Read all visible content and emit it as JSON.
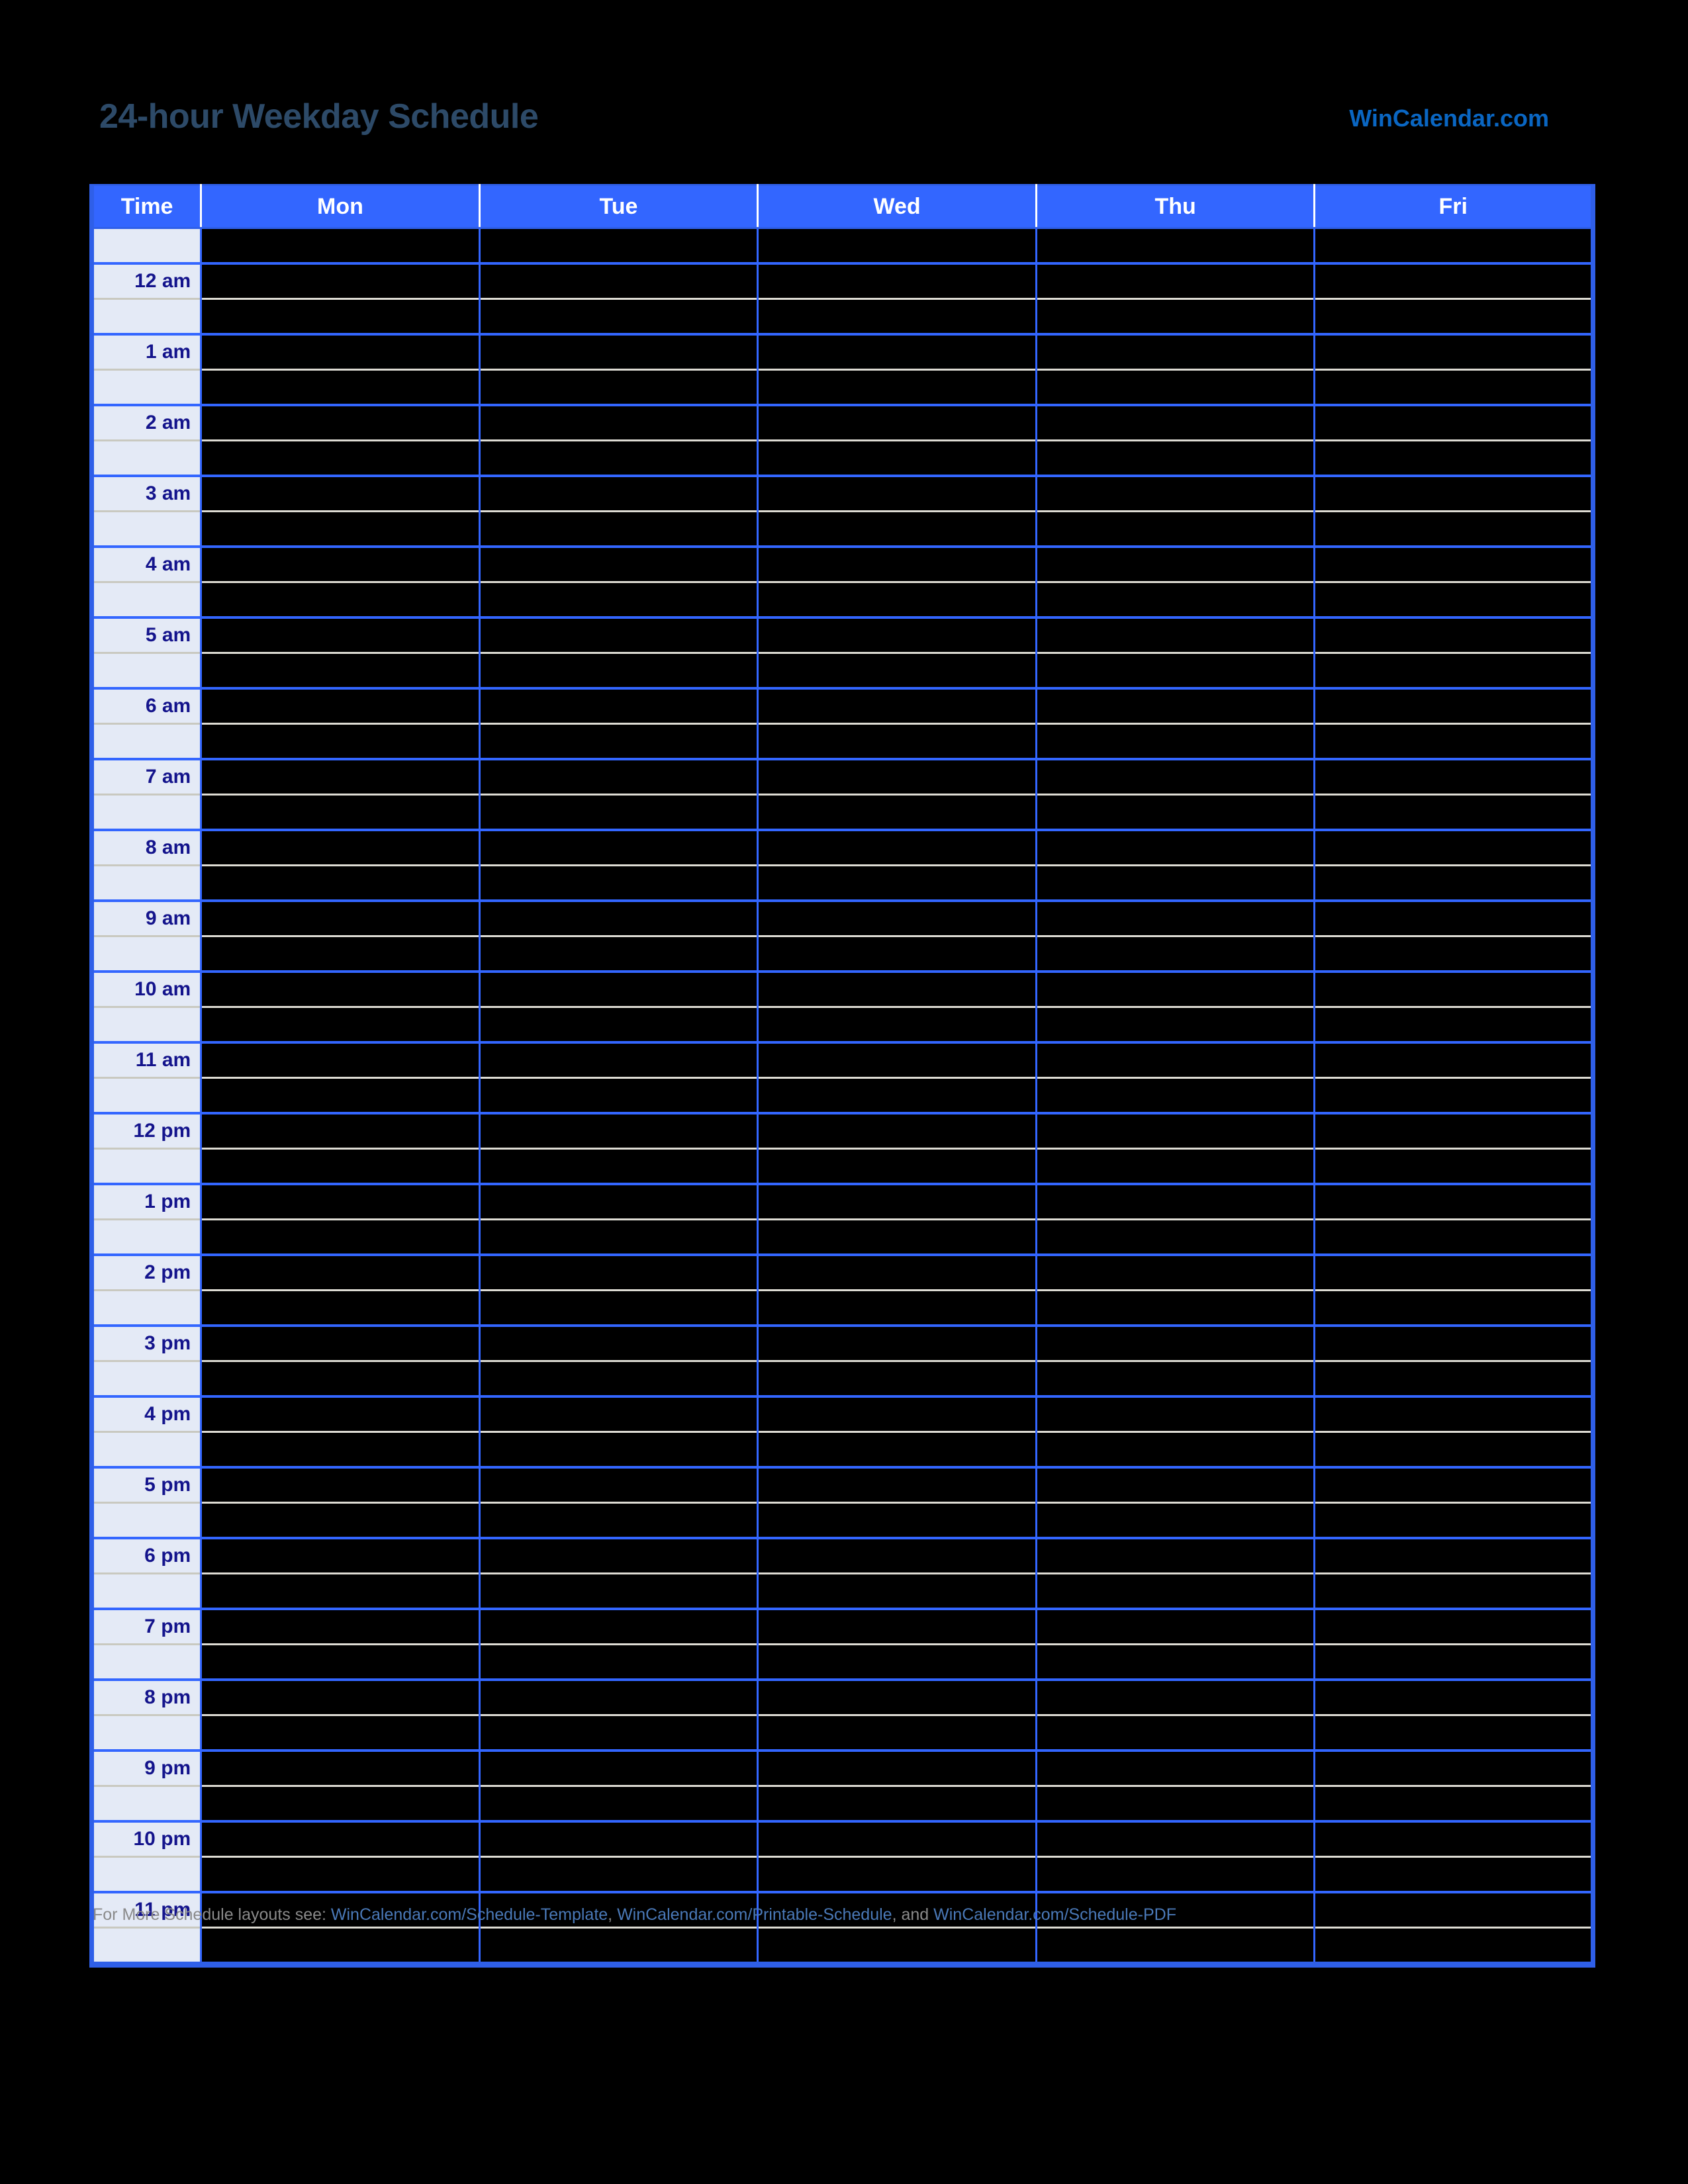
{
  "document": {
    "title": "24-hour Weekday Schedule",
    "brand": "WinCalendar.com"
  },
  "table": {
    "columns": [
      "Time",
      "Mon",
      "Tue",
      "Wed",
      "Thu",
      "Fri"
    ],
    "time_column_header": "Time",
    "day_headers": [
      "Mon",
      "Tue",
      "Wed",
      "Thu",
      "Fri"
    ],
    "hour_labels": [
      "12 am",
      "1 am",
      "2 am",
      "3 am",
      "4 am",
      "5 am",
      "6 am",
      "7 am",
      "8 am",
      "9 am",
      "10 am",
      "11 am",
      "12 pm",
      "1 pm",
      "2 pm",
      "3 pm",
      "4 pm",
      "5 pm",
      "6 pm",
      "7 pm",
      "8 pm",
      "9 pm",
      "10 pm",
      "11 pm"
    ],
    "has_lead_blank_row": true,
    "half_hour_rows_blank": true,
    "cell_values": []
  },
  "footer": {
    "intro": "For More Schedule layouts see: ",
    "link1": "WinCalendar.com/Schedule-Template",
    "sep1": ", ",
    "link2": "WinCalendar.com/Printable-Schedule",
    "sep2": ", and ",
    "link3": "WinCalendar.com/Schedule-PDF"
  },
  "colors": {
    "page_background": "#000000",
    "title": "#2d4a68",
    "brand": "#0a66c2",
    "header_row": "#3366ff",
    "header_text": "#ffffff",
    "time_cell_background": "#e4eaf6",
    "time_cell_text": "#14148c",
    "grid_blue": "#3366ff",
    "grid_light": "#dedcd4",
    "footer_text": "#8a8a8a",
    "footer_link": "#4a79b8"
  }
}
